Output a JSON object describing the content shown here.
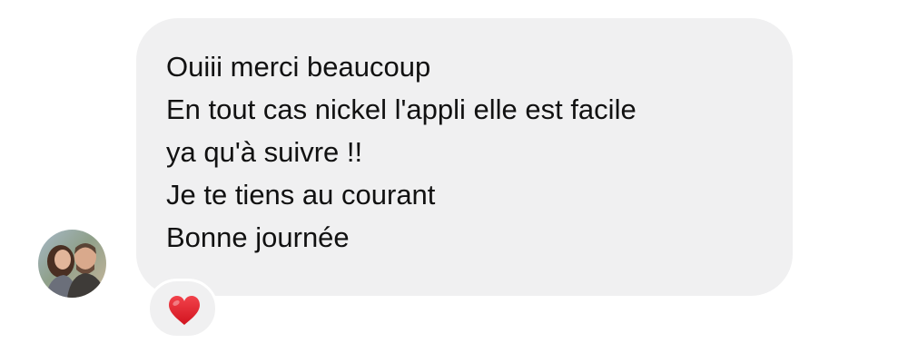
{
  "message": {
    "lines": [
      "Ouiii merci beaucoup",
      "En tout cas nickel l'appli elle est facile",
      "ya qu'à suivre !!",
      "Je te tiens au courant",
      "Bonne journée"
    ]
  },
  "reaction": {
    "icon": "red-heart-icon",
    "color": "#e0202a"
  },
  "colors": {
    "bubble": "#f0f0f1",
    "text": "#111111"
  }
}
